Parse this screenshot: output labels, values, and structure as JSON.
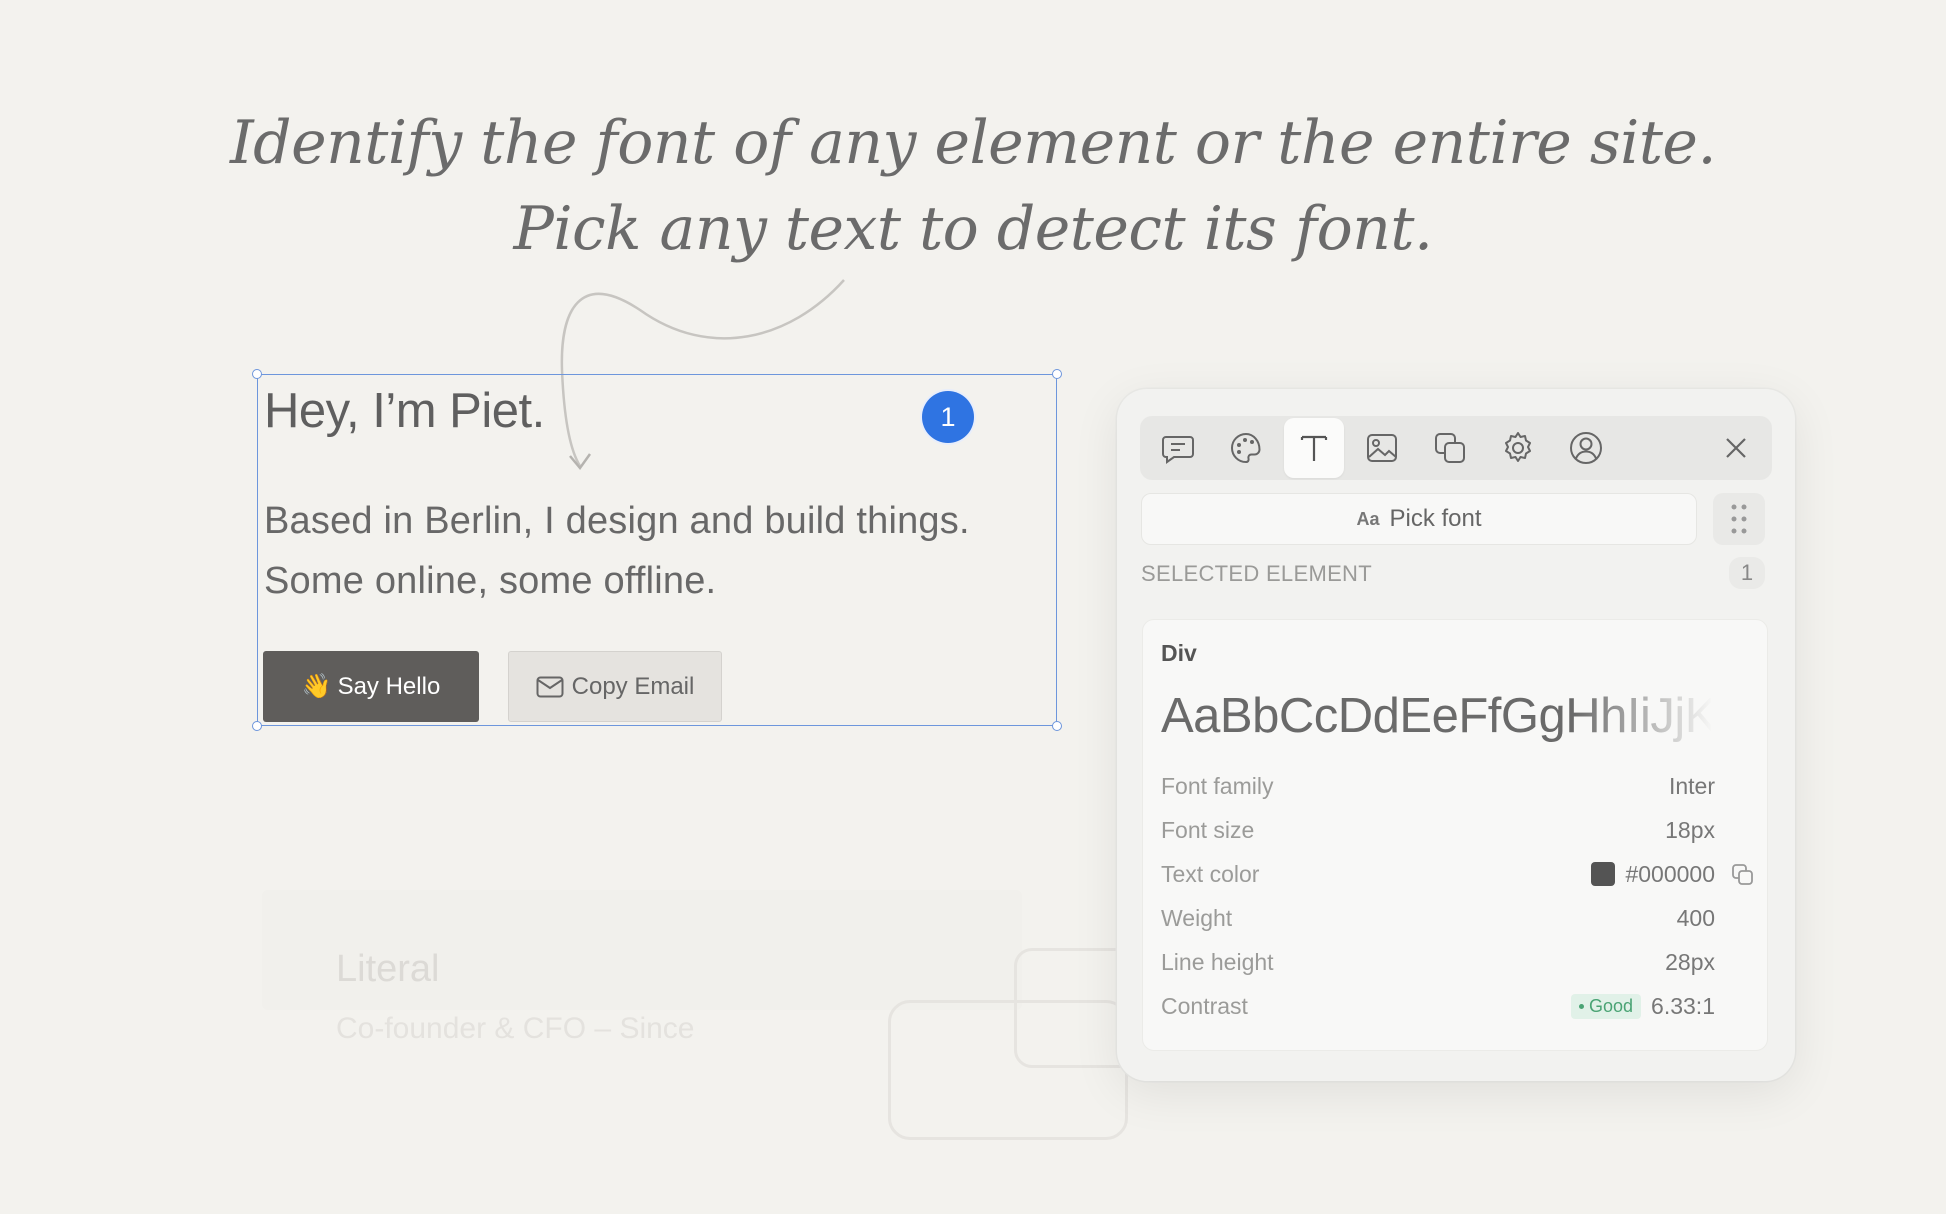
{
  "headline": {
    "line1": "Identify the font of any element or the entire site.",
    "line2": "Pick any text to detect its font."
  },
  "preview": {
    "title": "Hey, I’m Piet.",
    "text_line1": "Based in Berlin, I design and build things.",
    "text_line2": "Some online, some offline.",
    "badge": "1",
    "say_hello_emoji": "👋",
    "say_hello_label": "Say Hello",
    "copy_email_label": "Copy Email"
  },
  "background": {
    "title": "Literal",
    "subtitle": "Co-founder & CFO – Since"
  },
  "panel": {
    "tools": [
      {
        "icon": "comment-icon"
      },
      {
        "icon": "palette-icon"
      },
      {
        "icon": "text-icon",
        "active": true
      },
      {
        "icon": "image-icon"
      },
      {
        "icon": "copy-icon"
      },
      {
        "icon": "gear-icon"
      },
      {
        "icon": "user-icon"
      }
    ],
    "pick_font_prefix": "Aa",
    "pick_font_label": "Pick font",
    "section_label": "SELECTED ELEMENT",
    "section_count": "1",
    "card": {
      "title": "Div",
      "specimen": "AaBbCcDdEeFfGgHhIiJjKk",
      "rows": {
        "font_family": {
          "label": "Font family",
          "value": "Inter"
        },
        "font_size": {
          "label": "Font size",
          "value": "18px"
        },
        "text_color": {
          "label": "Text color",
          "value": "#000000",
          "swatch": "#545454"
        },
        "weight": {
          "label": "Weight",
          "value": "400"
        },
        "line_height": {
          "label": "Line height",
          "value": "28px"
        },
        "contrast": {
          "label": "Contrast",
          "badge": "Good",
          "value": "6.33:1"
        }
      }
    }
  },
  "colors": {
    "accent": "#2f74e2",
    "selection": "#6d96dc",
    "background": "#f3f2ee"
  }
}
